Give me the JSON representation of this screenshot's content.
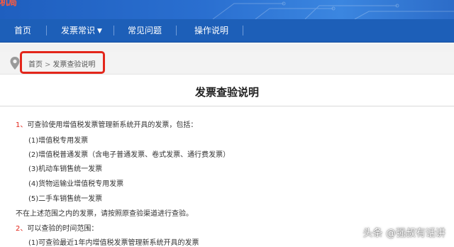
{
  "banner": {
    "logo_fragment": "机局"
  },
  "nav": {
    "items": [
      {
        "label": "首页"
      },
      {
        "label": "发票常识"
      },
      {
        "label": "常见问题"
      },
      {
        "label": "操作说明"
      }
    ]
  },
  "breadcrumb": {
    "home": "首页",
    "separator": ">",
    "current": "发票查验说明"
  },
  "content": {
    "title": "发票查验说明",
    "section1": {
      "number": "1、",
      "text": "可查验使用增值税发票管理新系统开具的发票，包括：",
      "items": [
        "(1)增值税专用发票",
        "(2)增值税普通发票（含电子普通发票、卷式发票、通行费发票）",
        "(3)机动车销售统一发票",
        "(4)货物运输业增值税专用发票",
        "(5)二手车销售统一发票"
      ]
    },
    "note": "不在上述范围之内的发票，请按照原查验渠道进行查验。",
    "section2": {
      "number": "2、",
      "text": "可以查验的时间范围：",
      "items": [
        "(1)可查验最近1年内增值税发票管理新系统开具的发票"
      ]
    }
  },
  "watermark": "头条 @强叔有话讲",
  "colors": {
    "nav_bg": "#1d5fb8",
    "highlight": "#e3261b",
    "number": "#e3261b"
  }
}
